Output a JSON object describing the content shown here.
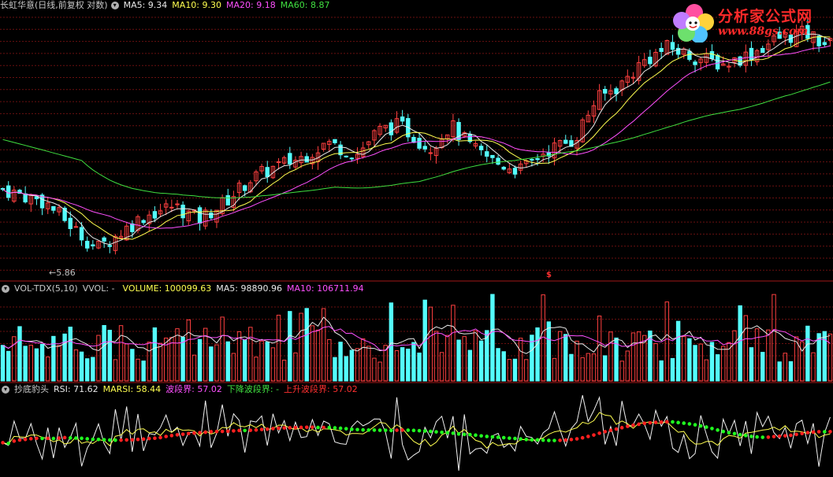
{
  "main_header": {
    "title": "长虹华意(日线,前复权 对数)",
    "ma5": "MA5: 9.34",
    "ma10": "MA10: 9.30",
    "ma20": "MA20: 9.18",
    "ma60": "MA60: 8.87"
  },
  "vol_header": {
    "name": "VOL-TDX(5,10)",
    "vvol": "VVOL: -",
    "volume": "VOLUME: 100099.63",
    "ma5": "MA5: 98890.96",
    "ma10": "MA10: 106711.94"
  },
  "rsi_header": {
    "name": "抄底豹头",
    "rsi": "RSI: 71.62",
    "marsi": "MARSI: 58.44",
    "band": "波段界: 57.02",
    "down": "下降波段界: -",
    "up": "上升波段界: 57.02"
  },
  "low_label": "←5.86",
  "signal_mark": "$",
  "logo": {
    "line1": "分析家公式网",
    "line2": "www.88gs.com"
  },
  "colors": {
    "up": "#ff4040",
    "down": "#54fcfc",
    "ma5": "#e8e8e8",
    "ma10": "#ffff50",
    "ma20": "#ff50ff",
    "ma60": "#40e040",
    "grid": "#6a1010",
    "rsi_up": "#ff2020",
    "rsi_down": "#20ff20"
  },
  "chart_data": [
    {
      "type": "candlestick",
      "title": "长虹华意(日线,前复权 对数)",
      "ylim": [
        5.7,
        10.0
      ],
      "log_scale": true,
      "grid": true,
      "lowest_marked": 5.86,
      "series": [
        {
          "name": "MA5",
          "last": 9.34
        },
        {
          "name": "MA10",
          "last": 9.3
        },
        {
          "name": "MA20",
          "last": 9.18
        },
        {
          "name": "MA60",
          "last": 8.87
        }
      ]
    },
    {
      "type": "bar",
      "title": "VOL-TDX(5,10)",
      "series": [
        {
          "name": "VOLUME",
          "last": 100099.63
        },
        {
          "name": "MA5",
          "last": 98890.96
        },
        {
          "name": "MA10",
          "last": 106711.94
        }
      ]
    },
    {
      "type": "line",
      "title": "抄底豹头",
      "series": [
        {
          "name": "RSI",
          "last": 71.62
        },
        {
          "name": "MARSI",
          "last": 58.44
        },
        {
          "name": "波段界",
          "last": 57.02
        },
        {
          "name": "下降波段界",
          "last": "-"
        },
        {
          "name": "上升波段界",
          "last": 57.02
        }
      ]
    }
  ]
}
